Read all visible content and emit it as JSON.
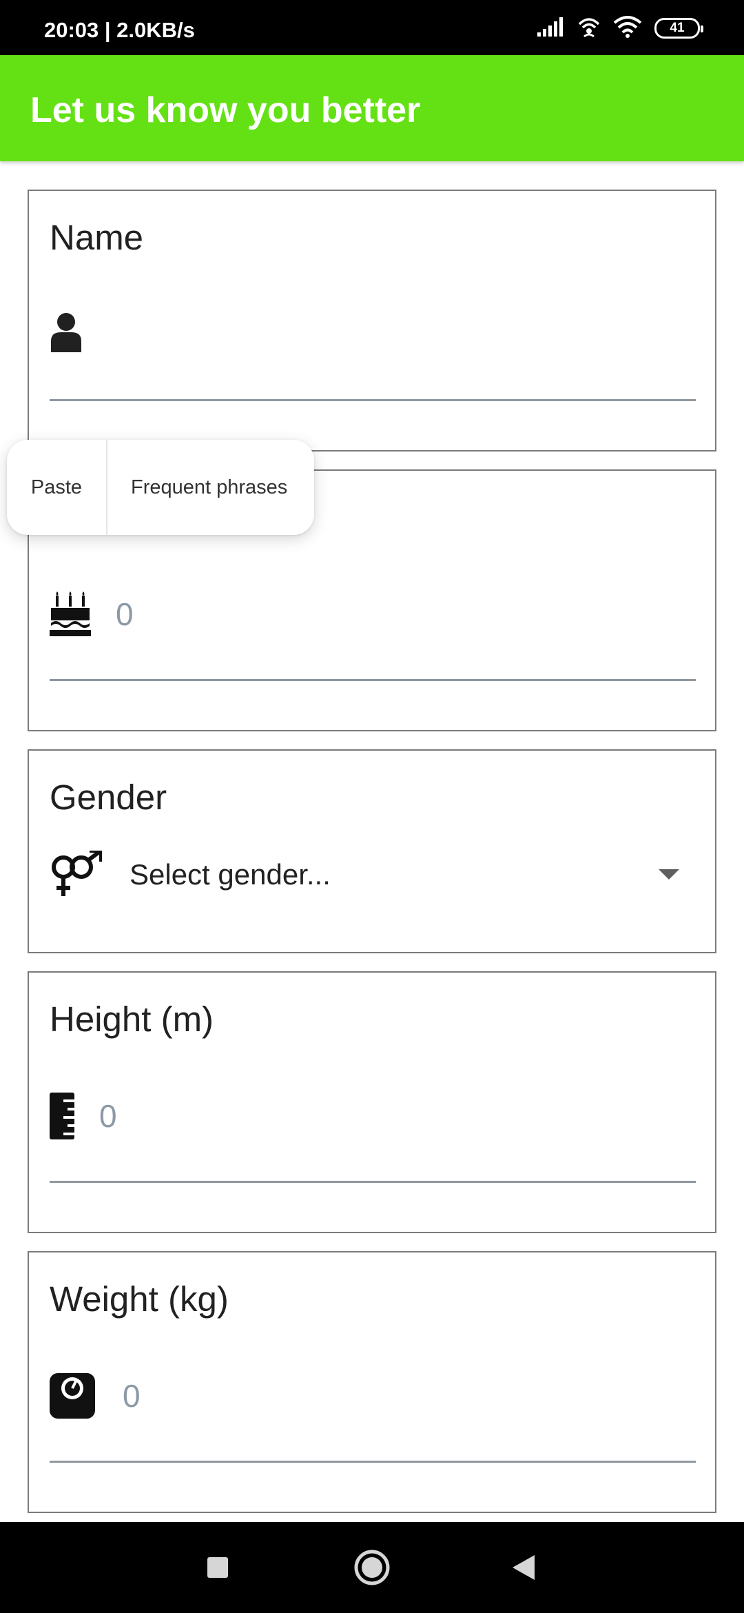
{
  "status_bar": {
    "time_speed": "20:03 | 2.0KB/s",
    "battery": "41"
  },
  "app_bar": {
    "title": "Let us know you better",
    "color": "#64e114"
  },
  "form": {
    "name": {
      "label": "Name",
      "value": ""
    },
    "age": {
      "value_placeholder": "0"
    },
    "gender": {
      "label": "Gender",
      "selected": "Select gender..."
    },
    "height": {
      "label": "Height (m)",
      "value_placeholder": "0"
    },
    "weight": {
      "label": "Weight (kg)",
      "value_placeholder": "0"
    }
  },
  "context_menu": {
    "paste": "Paste",
    "frequent_phrases": "Frequent phrases"
  },
  "icons": [
    "signal-icon",
    "hotspot-icon",
    "wifi-icon",
    "battery-icon",
    "user-icon",
    "birthday-cake-icon",
    "gender-icon",
    "ruler-icon",
    "scale-icon",
    "recents-square-icon",
    "home-circle-icon",
    "back-triangle-icon"
  ]
}
